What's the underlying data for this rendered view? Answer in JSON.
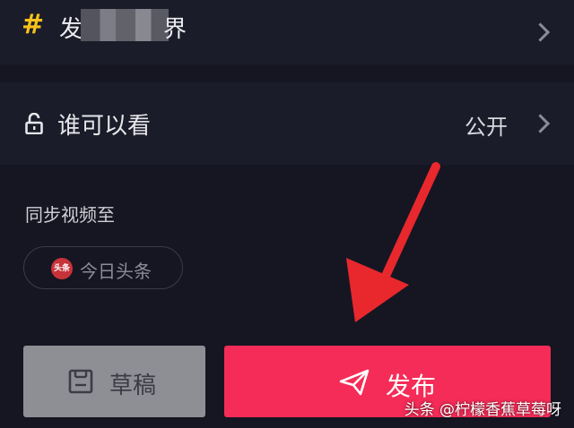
{
  "topic": {
    "hash": "#",
    "text_start": "发",
    "text_end": "界"
  },
  "privacy": {
    "label": "谁可以看",
    "value": "公开"
  },
  "sync": {
    "label": "同步视频至",
    "chip_icon_text": "头条",
    "chip_label": "今日头条"
  },
  "buttons": {
    "draft_label": "草稿",
    "publish_label": "发布"
  },
  "watermark": "头条 @柠檬香蕉草莓呀",
  "colors": {
    "publish": "#f52c57",
    "draft": "#8e8e95",
    "hash": "#f7c21c",
    "arrow": "#e8282d"
  }
}
